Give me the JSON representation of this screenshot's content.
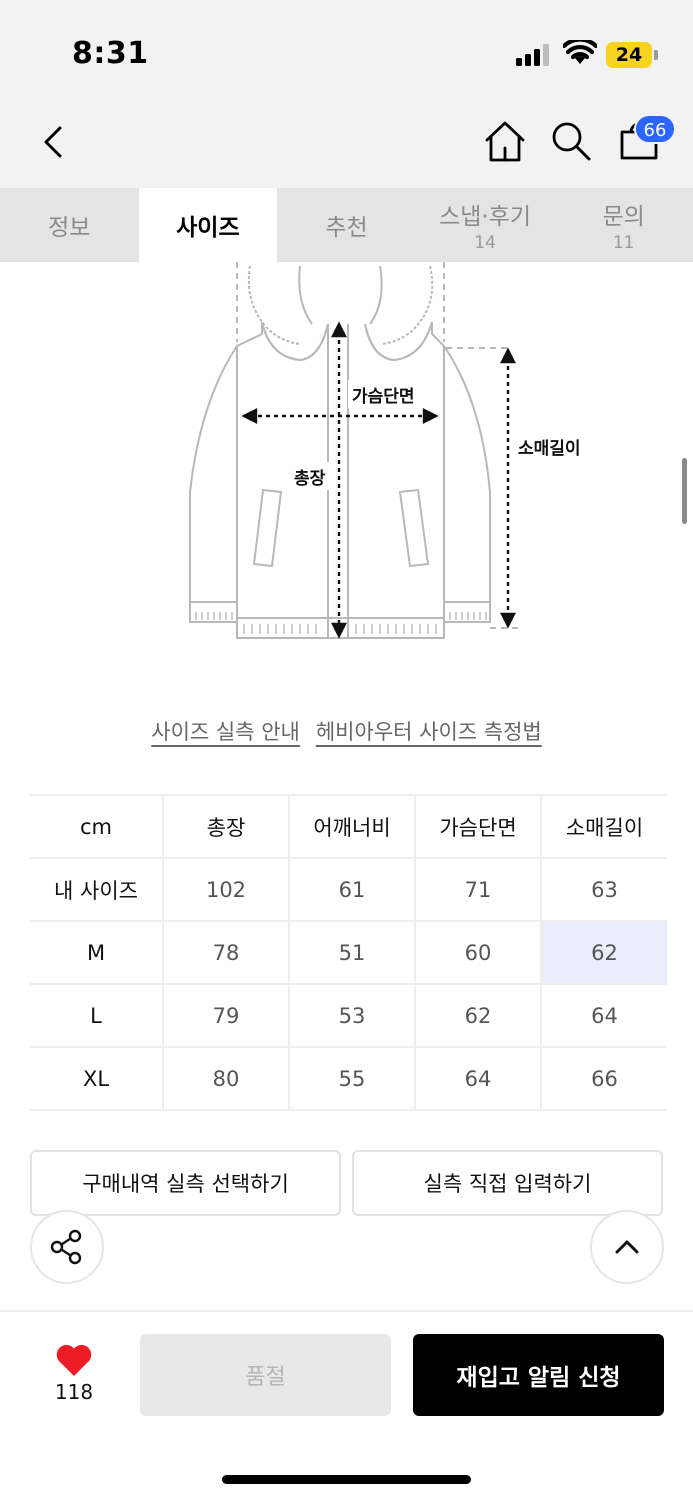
{
  "status_bar": {
    "time": "8:31",
    "battery": "24",
    "icons": [
      "signal-icon",
      "wifi-icon",
      "battery-icon"
    ]
  },
  "header": {
    "icons": [
      "back-icon",
      "home-icon",
      "search-icon",
      "bag-icon"
    ],
    "cart_count": "66"
  },
  "tabs": [
    {
      "label": "정보",
      "count": ""
    },
    {
      "label": "사이즈",
      "count": "",
      "active": true
    },
    {
      "label": "추천",
      "count": ""
    },
    {
      "label": "스냅·후기",
      "count": "14"
    },
    {
      "label": "문의",
      "count": "11"
    }
  ],
  "diagram": {
    "labels": {
      "chest": "가슴단면",
      "length": "총장",
      "sleeve": "소매길이"
    }
  },
  "links": {
    "size_guide": "사이즈 실측 안내",
    "measure_method": "헤비아우터 사이즈 측정법"
  },
  "size_table": {
    "unit": "cm",
    "columns": [
      "총장",
      "어깨너비",
      "가슴단면",
      "소매길이"
    ],
    "rows": [
      {
        "label": "내 사이즈",
        "values": [
          "102",
          "61",
          "71",
          "63"
        ]
      },
      {
        "label": "M",
        "values": [
          "78",
          "51",
          "60",
          "62"
        ]
      },
      {
        "label": "L",
        "values": [
          "79",
          "53",
          "62",
          "64"
        ]
      },
      {
        "label": "XL",
        "values": [
          "80",
          "55",
          "64",
          "66"
        ]
      }
    ],
    "highlight_color": "#e8ecfb"
  },
  "buttons": {
    "purchase_history": "구매내역 실측 선택하기",
    "manual_input": "실측 직접 입력하기"
  },
  "fabs": [
    "share-icon",
    "arrow-up-icon"
  ],
  "bottom_bar": {
    "like_count": "118",
    "sold_out": "품절",
    "restock_alert": "재입고 알림 신청"
  },
  "colors": {
    "accent": "#2c64ff",
    "heart": "#ee1c25",
    "battery": "#f7d21e"
  }
}
